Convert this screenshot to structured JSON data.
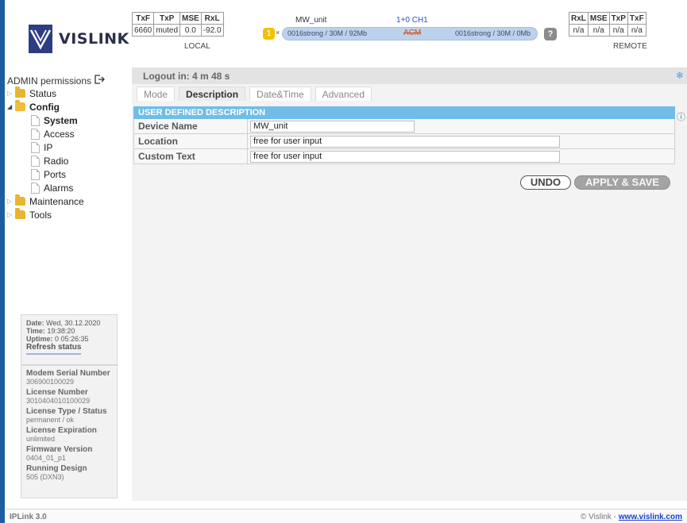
{
  "brand": {
    "name": "VISLINK"
  },
  "local_stats": {
    "headers": [
      "TxF",
      "TxP",
      "MSE",
      "RxL"
    ],
    "values": [
      "6660",
      "muted",
      "0.0",
      "-92.0"
    ],
    "label": "LOCAL"
  },
  "remote_stats": {
    "headers": [
      "RxL",
      "MSE",
      "TxP",
      "TxF"
    ],
    "values": [
      "n/a",
      "n/a",
      "n/a",
      "n/a"
    ],
    "label": "REMOTE"
  },
  "link": {
    "unit_name": "MW_unit",
    "channel": "1+0 CH1",
    "badge": "1",
    "arrow": "×",
    "left_status": "0016strong / 30M / 92Mb",
    "mode": "ACM",
    "right_status": "0016strong / 30M / 0Mb",
    "help": "?"
  },
  "sidebar": {
    "permissions": "ADMIN permissions",
    "tree": {
      "status": "Status",
      "config": "Config",
      "system": "System",
      "access": "Access",
      "ip": "IP",
      "radio": "Radio",
      "ports": "Ports",
      "alarms": "Alarms",
      "maintenance": "Maintenance",
      "tools": "Tools"
    },
    "date_info": {
      "date_label": "Date:",
      "date": "Wed, 30.12.2020",
      "time_label": "Time:",
      "time": "19:38:20",
      "uptime_label": "Uptime:",
      "uptime": "0 05:26:35",
      "refresh": "Refresh status"
    },
    "device_info": [
      {
        "label": "Modem Serial Number",
        "value": "306900100029"
      },
      {
        "label": "License Number",
        "value": "3010404010100029"
      },
      {
        "label": "License Type / Status",
        "value": "permanent / ok"
      },
      {
        "label": "License Expiration",
        "value": "unlimited"
      },
      {
        "label": "Firmware Version",
        "value": "0404_01_p1"
      },
      {
        "label": "Running Design",
        "value": "505 (DXN3)"
      }
    ]
  },
  "main": {
    "logout_text": "Logout in: 4 m 48 s",
    "tabs": [
      "Mode",
      "Description",
      "Date&Time",
      "Advanced"
    ],
    "section_title": "USER DEFINED DESCRIPTION",
    "fields": [
      {
        "label": "Device Name",
        "value": "MW_unit"
      },
      {
        "label": "Location",
        "value": "free for user input"
      },
      {
        "label": "Custom Text",
        "value": "free for user input"
      }
    ],
    "undo_label": "UNDO",
    "apply_label": "APPLY & SAVE"
  },
  "footer": {
    "product": "IPLink 3.0",
    "copyright": "© Vislink - ",
    "link_text": "www.vislink.com"
  },
  "colors": {
    "accent": "#6fbde8",
    "brand": "#2d3d82",
    "folder": "#e9b531",
    "link_bar": "#bcd2ec"
  }
}
